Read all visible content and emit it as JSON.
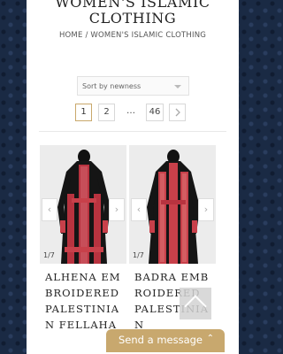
{
  "header": {
    "title": "WOMEN'S ISLAMIC CLOTHING",
    "breadcrumb": {
      "home": "HOME",
      "separator": " / ",
      "current": "WOMEN'S ISLAMIC CLOTHING"
    }
  },
  "sort": {
    "selected": "Sort by newness"
  },
  "pagination": {
    "pages": [
      "1",
      "2"
    ],
    "ellipsis": "…",
    "last": "46",
    "next_icon": "chevron-right-icon",
    "current": "1"
  },
  "products": [
    {
      "name": "ALHENA EMBROIDERED PALESTINIAN FELLAHA",
      "counter": "1/7",
      "prev": "‹",
      "next": "›"
    },
    {
      "name": "BADRA EMBROIDERED PALESTINIAN",
      "counter": "1/7",
      "prev": "‹",
      "next": "›"
    }
  ],
  "chat": {
    "label": "Send a message",
    "caret": "⌃"
  },
  "colors": {
    "accent": "#c8a86e",
    "background": "#1a2a44",
    "embroidery": "#c8404a"
  }
}
